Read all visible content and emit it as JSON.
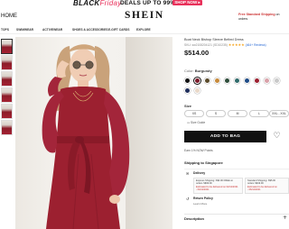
{
  "promo": {
    "black": "BLACK",
    "friday": "Friday",
    "deals": "DEALS UP TO 99% OFF",
    "shop_now": "SHOP NOW ▸"
  },
  "header": {
    "home": "HOME",
    "logo": "SHEIN",
    "free_shipping": "Free Standard Shipping",
    "free_shipping_suffix": " on orders"
  },
  "nav": {
    "items": [
      "TOPS",
      "SWIMWEAR",
      "ACTIVEWEAR",
      "SHOES & ACCESSORIES",
      "E-GIFT CARDS",
      "EXPLORE"
    ]
  },
  "thumbnails": {
    "count": 6,
    "selected_index": 0
  },
  "product": {
    "title": "Boat Neck Bishop Sleeve Belted Dress",
    "sku": "SKU: sw2108204121 (SD10235)",
    "stars": "★★★★★",
    "reviews": "(464+ Reviews)",
    "price": "$514.00",
    "color_label": "Color:",
    "color_value": "Burgundy",
    "swatches": [
      "#111111",
      "#7c1b2a",
      "#5a4a2a",
      "#c78a3a",
      "#2e4d3a",
      "#2f6b6b",
      "#1e4b86",
      "#9c2030",
      "#d9a0a8",
      "#c9c9c9",
      "#1e2d5a",
      "#e9d8c8"
    ],
    "selected_swatch": 1,
    "size_label": "Size",
    "sizes": [
      "XS",
      "S",
      "M",
      "L",
      "XXL - XXL"
    ],
    "size_guide": "Size Guide",
    "add_to_bag": "ADD TO BAG",
    "points": "Earn 1% NOW Points",
    "ship_to": "Shipping to Singapore",
    "delivery_label": "Delivery",
    "express": {
      "line1": "Express Shipping: S$0.00 FREE on",
      "line2": "orders S$99.00",
      "line3": "Estimated to be delivered on 02/12/2021",
      "line4": "- 04/12/2021"
    },
    "standard": {
      "line1": "Standard Shipping: S$5.00",
      "line2": "orders S$49.00",
      "line3": "Estimated to be delivered on",
      "line4": "- 06/12/2021"
    },
    "return_label": "Return Policy",
    "learn_more": "Learn More",
    "description": "Description"
  },
  "icons": {
    "heart": "heart-icon",
    "plus": "plus-icon",
    "check": "truck-icon",
    "return": "return-icon"
  },
  "colors": {
    "accent": "#e8305a",
    "button": "#111111",
    "dress": "#9c2030"
  }
}
